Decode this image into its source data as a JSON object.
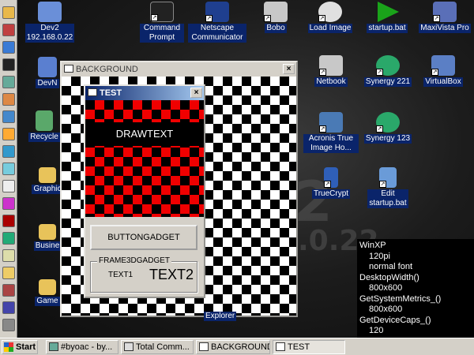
{
  "desktop": {
    "icons_row1": [
      {
        "name": "dev2-icon",
        "label": "Dev2\n192.168.0.22",
        "glyph": "computer-icon",
        "color": "#6a8fd8"
      },
      {
        "name": "command-prompt-icon",
        "label": "Command Prompt",
        "glyph": "console-icon",
        "color": "#222222"
      },
      {
        "name": "netscape-icon",
        "label": "Netscape Communicator",
        "glyph": "netscape-icon",
        "color": "#1f3f8f"
      },
      {
        "name": "bobo-icon",
        "label": "Bobo",
        "glyph": "nc-icon",
        "color": "#c8c8c8"
      },
      {
        "name": "load-image-icon",
        "label": "Load Image",
        "glyph": "disc-icon",
        "color": "#e0e0e0"
      },
      {
        "name": "startup-bat-icon",
        "label": "startup.bat",
        "glyph": "play-icon",
        "color": "#1aa31a"
      },
      {
        "name": "maxivista-icon",
        "label": "MaxiVista Pro",
        "glyph": "monitor-icon",
        "color": "#5a6fb8"
      }
    ],
    "icons_row2": [
      {
        "name": "netbook-icon",
        "label": "Netbook",
        "glyph": "nc-icon"
      },
      {
        "name": "synergy-221-icon",
        "label": "Synergy 221",
        "glyph": "synergy-icon"
      },
      {
        "name": "virtualbox-icon",
        "label": "VirtualBox",
        "glyph": "cube-icon"
      }
    ],
    "icons_row3": [
      {
        "name": "acronis-icon",
        "label": "Acronis True Image Ho...",
        "glyph": "acronis-icon"
      },
      {
        "name": "synergy-123-icon",
        "label": "Synergy 123",
        "glyph": "synergy-icon"
      }
    ],
    "icons_row4": [
      {
        "name": "truecrypt-icon",
        "label": "TrueCrypt",
        "glyph": "key-icon"
      },
      {
        "name": "edit-startup-icon",
        "label": "Edit\nstartup.bat",
        "glyph": "notepad-icon"
      }
    ],
    "left_icons": [
      {
        "name": "devnet-icon",
        "label": "DevN"
      },
      {
        "name": "recycle-bin-icon",
        "label": "Recycle"
      },
      {
        "name": "graphics-folder-icon",
        "label": "Graphic"
      },
      {
        "name": "business-folder-icon",
        "label": "Busine"
      },
      {
        "name": "games-folder-icon",
        "label": "Game"
      }
    ],
    "explorer_label": "Explorer",
    "wallpaper_big": "2",
    "wallpaper_small": ".0.22"
  },
  "background_window": {
    "title": "BACKGROUND",
    "close": "×"
  },
  "test_window": {
    "title": "TEST",
    "close": "×",
    "drawtext": "DRAWTEXT",
    "button_gadget": "BUTTONGADGET",
    "frame_caption": "FRAME3DGADGET",
    "text1": "TEXT1",
    "text2": "TEXT2"
  },
  "info": {
    "os": "WinXP",
    "dpi": "120pi",
    "font": "normal font",
    "desktop_width_label": "DesktopWidth()",
    "desktop_width_value": "800x600",
    "metrics_label": "GetSystemMetrics_()",
    "metrics_value": "800x600",
    "devicecaps_label": "GetDeviceCaps_()",
    "devicecaps_value": "120"
  },
  "taskbar": {
    "start": "Start",
    "items": [
      {
        "name": "taskbar-byoac",
        "label": "#byoac - by..."
      },
      {
        "name": "taskbar-total-commander",
        "label": "Total Comm..."
      },
      {
        "name": "taskbar-background",
        "label": "BACKGROUND"
      },
      {
        "name": "taskbar-test",
        "label": "TEST",
        "active": true
      }
    ]
  }
}
